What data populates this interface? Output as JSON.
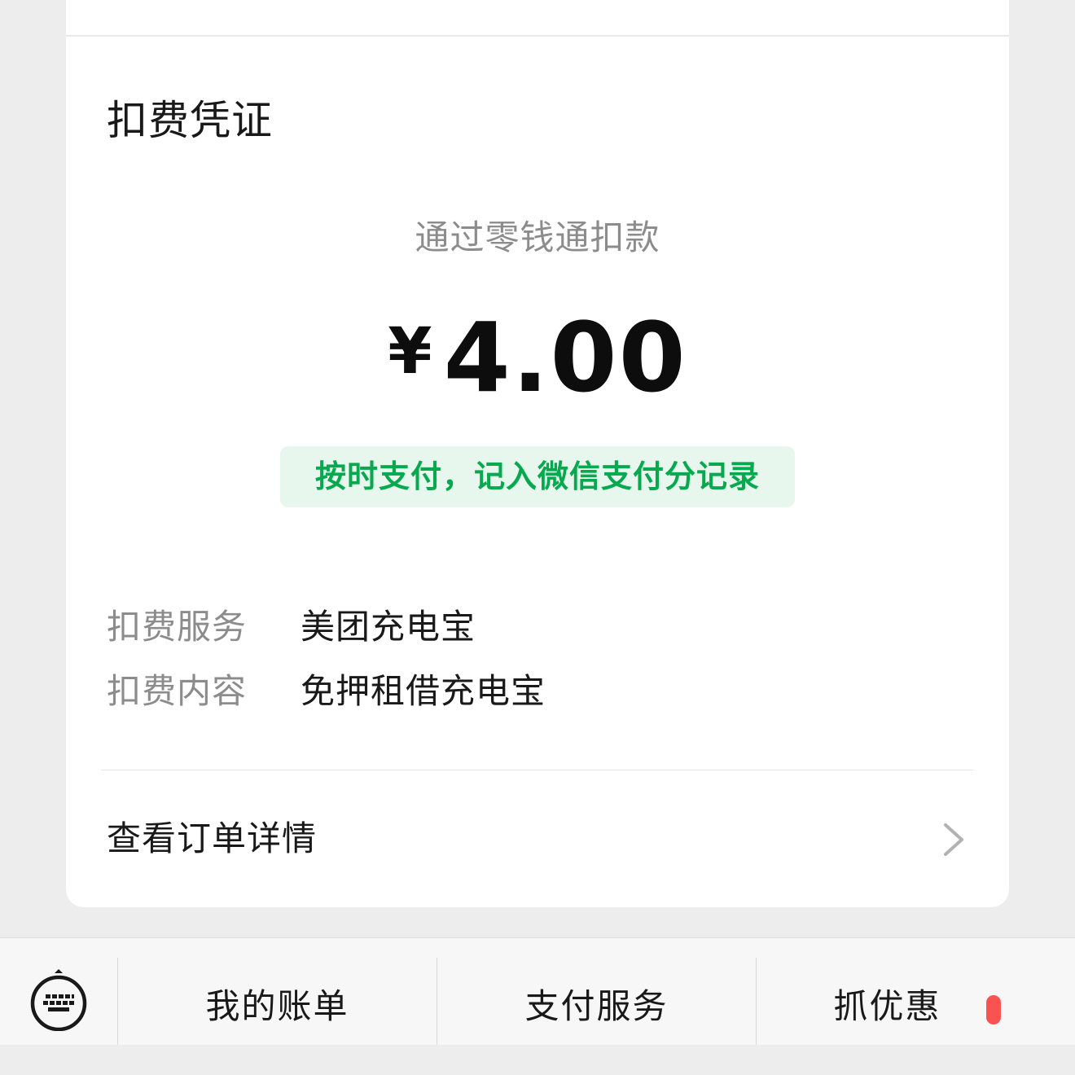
{
  "card": {
    "title": "扣费凭证",
    "pay_method": "通过零钱通扣款",
    "currency_symbol": "¥",
    "amount": "4.00",
    "badge": "按时支付，记入微信支付分记录",
    "rows": [
      {
        "label": "扣费服务",
        "value": "美团充电宝"
      },
      {
        "label": "扣费内容",
        "value": "免押租借充电宝"
      }
    ],
    "detail_link": "查看订单详情"
  },
  "bottom_bar": {
    "tabs": [
      "我的账单",
      "支付服务",
      "抓优惠"
    ],
    "icons": {
      "keyboard": "keyboard-icon",
      "chevron": "chevron-right-icon"
    }
  },
  "colors": {
    "accent_green": "#07a94f",
    "badge_bg": "#e7f7ee",
    "notice_red": "#fa5151"
  }
}
